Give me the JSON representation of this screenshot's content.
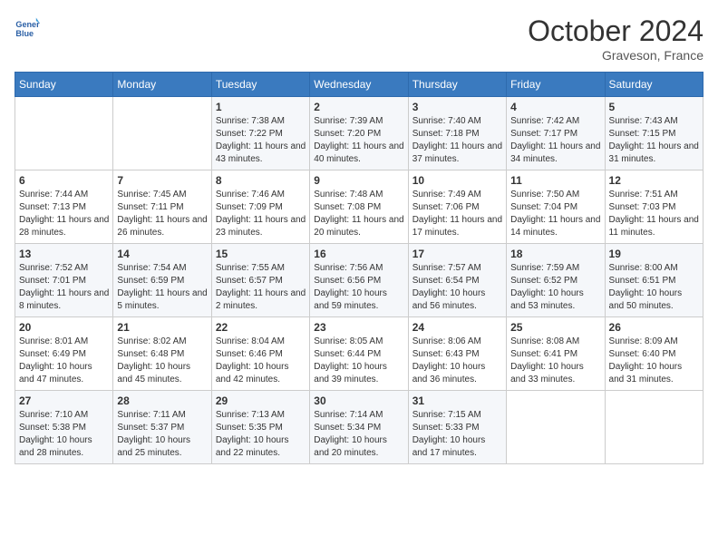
{
  "header": {
    "logo_line1": "General",
    "logo_line2": "Blue",
    "month_title": "October 2024",
    "location": "Graveson, France"
  },
  "days_of_week": [
    "Sunday",
    "Monday",
    "Tuesday",
    "Wednesday",
    "Thursday",
    "Friday",
    "Saturday"
  ],
  "weeks": [
    [
      {
        "day": "",
        "info": ""
      },
      {
        "day": "",
        "info": ""
      },
      {
        "day": "1",
        "sunrise": "7:38 AM",
        "sunset": "7:22 PM",
        "daylight": "11 hours and 43 minutes."
      },
      {
        "day": "2",
        "sunrise": "7:39 AM",
        "sunset": "7:20 PM",
        "daylight": "11 hours and 40 minutes."
      },
      {
        "day": "3",
        "sunrise": "7:40 AM",
        "sunset": "7:18 PM",
        "daylight": "11 hours and 37 minutes."
      },
      {
        "day": "4",
        "sunrise": "7:42 AM",
        "sunset": "7:17 PM",
        "daylight": "11 hours and 34 minutes."
      },
      {
        "day": "5",
        "sunrise": "7:43 AM",
        "sunset": "7:15 PM",
        "daylight": "11 hours and 31 minutes."
      }
    ],
    [
      {
        "day": "6",
        "sunrise": "7:44 AM",
        "sunset": "7:13 PM",
        "daylight": "11 hours and 28 minutes."
      },
      {
        "day": "7",
        "sunrise": "7:45 AM",
        "sunset": "7:11 PM",
        "daylight": "11 hours and 26 minutes."
      },
      {
        "day": "8",
        "sunrise": "7:46 AM",
        "sunset": "7:09 PM",
        "daylight": "11 hours and 23 minutes."
      },
      {
        "day": "9",
        "sunrise": "7:48 AM",
        "sunset": "7:08 PM",
        "daylight": "11 hours and 20 minutes."
      },
      {
        "day": "10",
        "sunrise": "7:49 AM",
        "sunset": "7:06 PM",
        "daylight": "11 hours and 17 minutes."
      },
      {
        "day": "11",
        "sunrise": "7:50 AM",
        "sunset": "7:04 PM",
        "daylight": "11 hours and 14 minutes."
      },
      {
        "day": "12",
        "sunrise": "7:51 AM",
        "sunset": "7:03 PM",
        "daylight": "11 hours and 11 minutes."
      }
    ],
    [
      {
        "day": "13",
        "sunrise": "7:52 AM",
        "sunset": "7:01 PM",
        "daylight": "11 hours and 8 minutes."
      },
      {
        "day": "14",
        "sunrise": "7:54 AM",
        "sunset": "6:59 PM",
        "daylight": "11 hours and 5 minutes."
      },
      {
        "day": "15",
        "sunrise": "7:55 AM",
        "sunset": "6:57 PM",
        "daylight": "11 hours and 2 minutes."
      },
      {
        "day": "16",
        "sunrise": "7:56 AM",
        "sunset": "6:56 PM",
        "daylight": "10 hours and 59 minutes."
      },
      {
        "day": "17",
        "sunrise": "7:57 AM",
        "sunset": "6:54 PM",
        "daylight": "10 hours and 56 minutes."
      },
      {
        "day": "18",
        "sunrise": "7:59 AM",
        "sunset": "6:52 PM",
        "daylight": "10 hours and 53 minutes."
      },
      {
        "day": "19",
        "sunrise": "8:00 AM",
        "sunset": "6:51 PM",
        "daylight": "10 hours and 50 minutes."
      }
    ],
    [
      {
        "day": "20",
        "sunrise": "8:01 AM",
        "sunset": "6:49 PM",
        "daylight": "10 hours and 47 minutes."
      },
      {
        "day": "21",
        "sunrise": "8:02 AM",
        "sunset": "6:48 PM",
        "daylight": "10 hours and 45 minutes."
      },
      {
        "day": "22",
        "sunrise": "8:04 AM",
        "sunset": "6:46 PM",
        "daylight": "10 hours and 42 minutes."
      },
      {
        "day": "23",
        "sunrise": "8:05 AM",
        "sunset": "6:44 PM",
        "daylight": "10 hours and 39 minutes."
      },
      {
        "day": "24",
        "sunrise": "8:06 AM",
        "sunset": "6:43 PM",
        "daylight": "10 hours and 36 minutes."
      },
      {
        "day": "25",
        "sunrise": "8:08 AM",
        "sunset": "6:41 PM",
        "daylight": "10 hours and 33 minutes."
      },
      {
        "day": "26",
        "sunrise": "8:09 AM",
        "sunset": "6:40 PM",
        "daylight": "10 hours and 31 minutes."
      }
    ],
    [
      {
        "day": "27",
        "sunrise": "7:10 AM",
        "sunset": "5:38 PM",
        "daylight": "10 hours and 28 minutes."
      },
      {
        "day": "28",
        "sunrise": "7:11 AM",
        "sunset": "5:37 PM",
        "daylight": "10 hours and 25 minutes."
      },
      {
        "day": "29",
        "sunrise": "7:13 AM",
        "sunset": "5:35 PM",
        "daylight": "10 hours and 22 minutes."
      },
      {
        "day": "30",
        "sunrise": "7:14 AM",
        "sunset": "5:34 PM",
        "daylight": "10 hours and 20 minutes."
      },
      {
        "day": "31",
        "sunrise": "7:15 AM",
        "sunset": "5:33 PM",
        "daylight": "10 hours and 17 minutes."
      },
      {
        "day": "",
        "info": ""
      },
      {
        "day": "",
        "info": ""
      }
    ]
  ]
}
